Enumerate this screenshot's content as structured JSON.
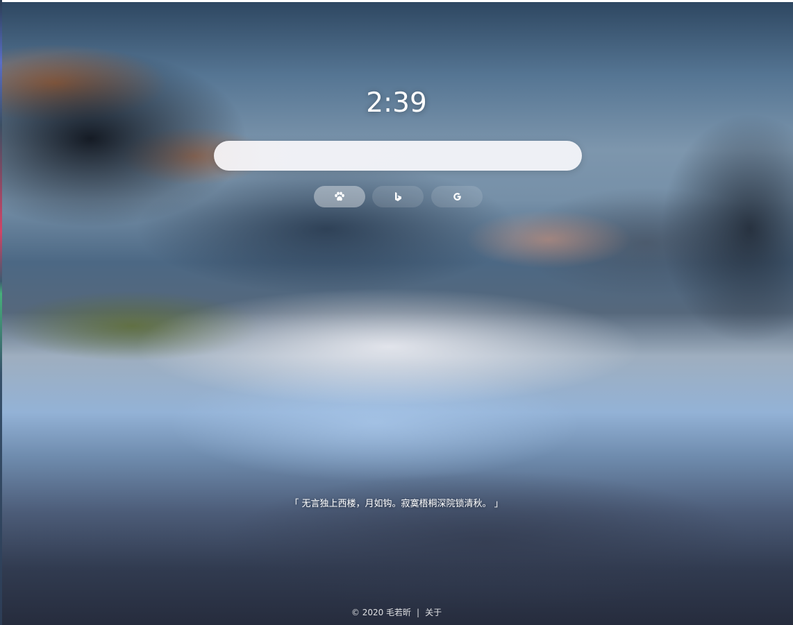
{
  "clock": {
    "time": "2:39"
  },
  "search": {
    "placeholder": "",
    "value": ""
  },
  "engines": [
    {
      "name": "baidu",
      "icon": "paw-icon",
      "active": true
    },
    {
      "name": "bing",
      "icon": "bing-icon",
      "active": false
    },
    {
      "name": "google",
      "icon": "google-icon",
      "active": false
    }
  ],
  "quote": {
    "text": "「 无言独上西楼，月如钩。寂寞梧桐深院锁清秋。 」"
  },
  "footer": {
    "copyright": "© 2020 毛若昕",
    "separator": "|",
    "about": "关于"
  }
}
